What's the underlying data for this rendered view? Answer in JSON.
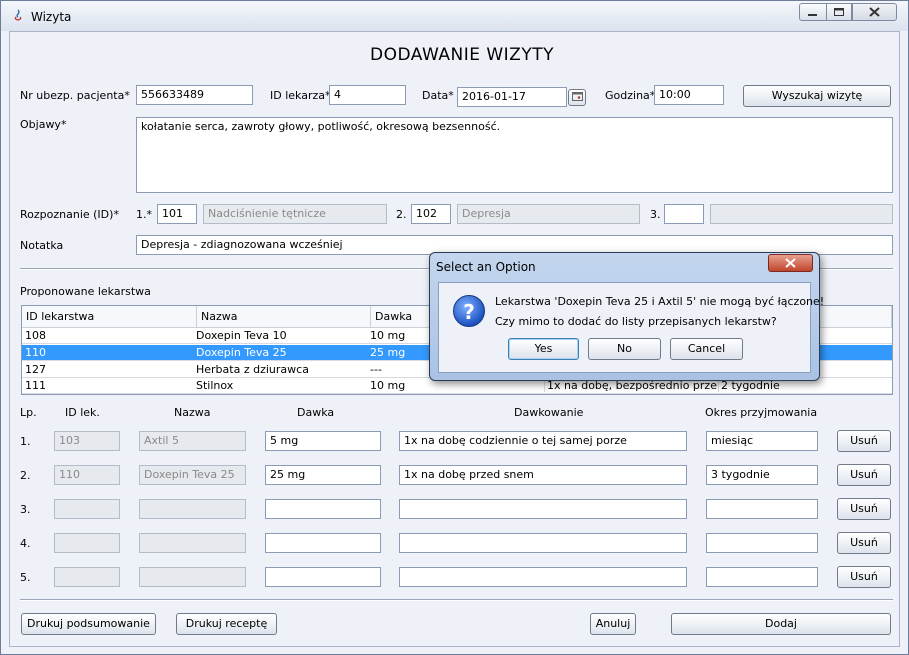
{
  "window": {
    "title": "Wizyta"
  },
  "form": {
    "heading": "DODAWANIE WIZYTY",
    "patient_label": "Nr ubezp. pacjenta*",
    "patient_value": "556633489",
    "doctor_label": "ID lekarza*",
    "doctor_value": "4",
    "date_label": "Data*",
    "date_value": "2016-01-17",
    "time_label": "Godzina*",
    "time_value": "10:00",
    "search_button": "Wyszukaj wizytę",
    "symptoms_label": "Objawy*",
    "symptoms_value": "kołatanie serca, zawroty głowy, potliwość, okresową bezsenność.",
    "diagnosis_label": "Rozpoznanie (ID)*",
    "diag": [
      {
        "num": "1.*",
        "id": "101",
        "name": "Nadciśnienie tętnicze"
      },
      {
        "num": "2.",
        "id": "102",
        "name": "Depresja"
      },
      {
        "num": "3.",
        "id": "",
        "name": ""
      }
    ],
    "note_label": "Notatka",
    "note_value": "Depresja - zdiagnozowana wcześniej"
  },
  "proposed": {
    "title": "Proponowane lekarstwa",
    "columns": [
      "ID lekarstwa",
      "Nazwa",
      "Dawka"
    ],
    "rows": [
      {
        "id": "108",
        "name": "Doxepin Teva 10",
        "dose": "10 mg",
        "dosing": "",
        "period": ""
      },
      {
        "id": "110",
        "name": "Doxepin Teva 25",
        "dose": "25 mg",
        "dosing": "",
        "period": ""
      },
      {
        "id": "127",
        "name": "Herbata z dziurawca",
        "dose": "---",
        "dosing": "",
        "period": ""
      },
      {
        "id": "111",
        "name": "Stilnox",
        "dose": "10 mg",
        "dosing": "1x na dobę, bezpośrednio przed ...",
        "period": "2 tygodnie"
      }
    ]
  },
  "prescribed": {
    "headers": {
      "lp": "Lp.",
      "id": "ID lek.",
      "name": "Nazwa",
      "dose": "Dawka",
      "dosing": "Dawkowanie",
      "period": "Okres przyjmowania"
    },
    "remove_label": "Usuń",
    "rows": [
      {
        "lp": "1.",
        "id": "103",
        "name": "Axtil 5",
        "dose": "5 mg",
        "dosing": "1x na dobę codziennie o tej samej porze",
        "period": "miesiąc"
      },
      {
        "lp": "2.",
        "id": "110",
        "name": "Doxepin Teva 25",
        "dose": "25 mg",
        "dosing": "1x na dobę przed snem",
        "period": "3 tygodnie"
      },
      {
        "lp": "3.",
        "id": "",
        "name": "",
        "dose": "",
        "dosing": "",
        "period": ""
      },
      {
        "lp": "4.",
        "id": "",
        "name": "",
        "dose": "",
        "dosing": "",
        "period": ""
      },
      {
        "lp": "5.",
        "id": "",
        "name": "",
        "dose": "",
        "dosing": "",
        "period": ""
      }
    ]
  },
  "footer": {
    "print_summary": "Drukuj podsumowanie",
    "print_prescription": "Drukuj receptę",
    "cancel": "Anuluj",
    "add": "Dodaj"
  },
  "dialog": {
    "title": "Select an Option",
    "line1": "Lekarstwa 'Doxepin Teva 25 i Axtil 5' nie mogą być łączone!",
    "line2": "Czy mimo to dodać do listy przepisanych lekarstw?",
    "yes": "Yes",
    "no": "No",
    "cancel": "Cancel",
    "icon": "question-icon"
  }
}
